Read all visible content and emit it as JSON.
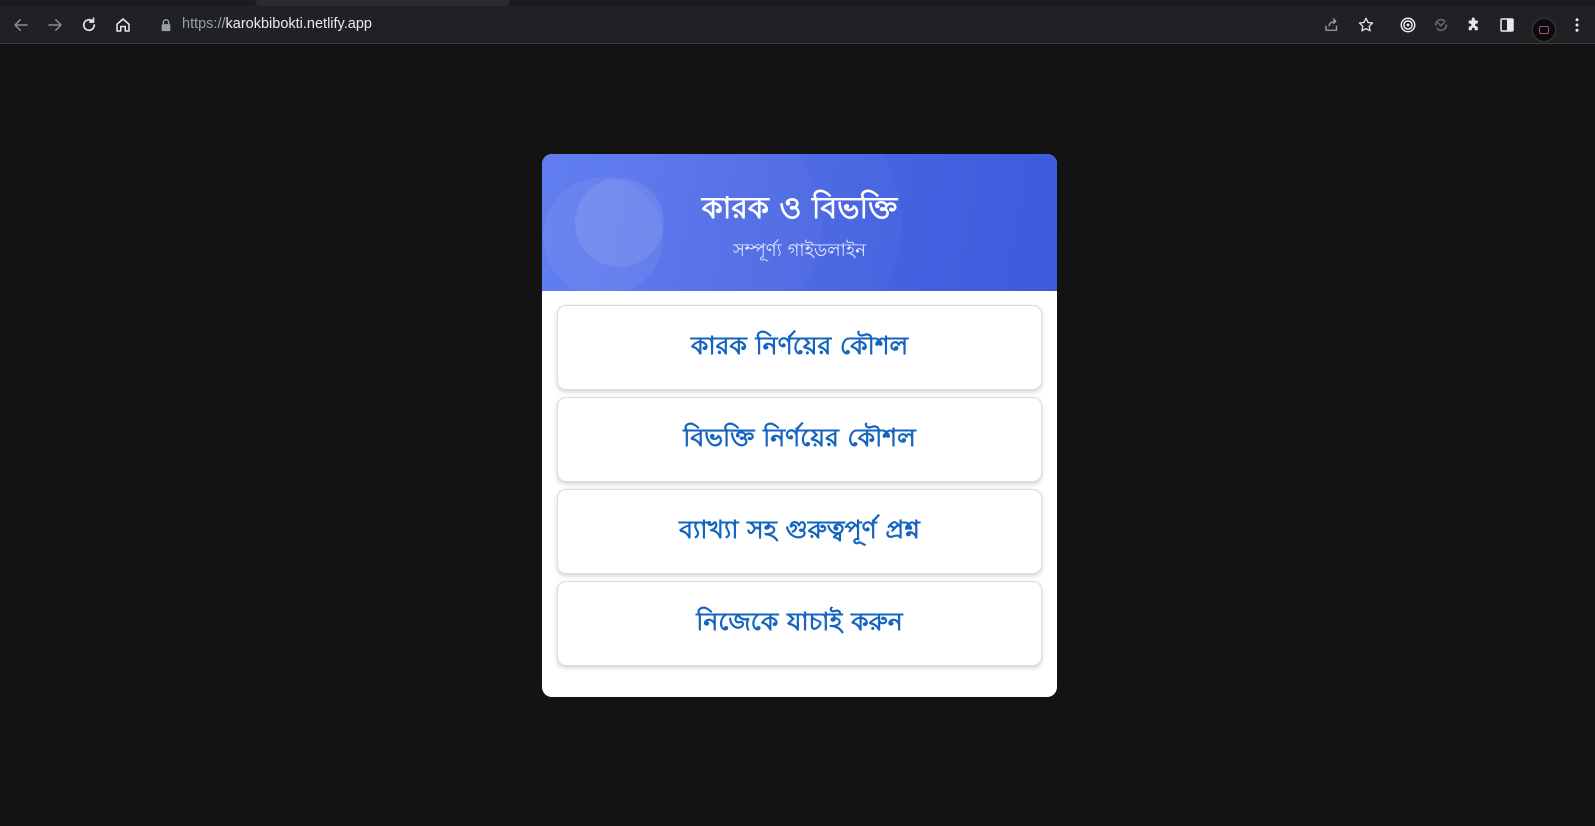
{
  "browser": {
    "url_scheme": "https://",
    "url_host": "karokbibokti.netlify.app"
  },
  "icons": {
    "back": "arrow-left-icon",
    "forward": "arrow-right-icon",
    "reload": "reload-icon",
    "home": "home-icon",
    "lock": "lock-icon",
    "share": "share-icon",
    "bookmark": "star-icon",
    "extension1": "target-icon",
    "extension2": "sync-icon",
    "extensions": "puzzle-icon",
    "sidepanel": "side-panel-icon",
    "menu": "kebab-menu-icon"
  },
  "colors": {
    "header_gradient_start": "#5a78f0",
    "header_gradient_end": "#3b5bdb",
    "button_text": "#1565c0",
    "page_background": "#131313"
  },
  "card": {
    "title": "কারক ও বিভক্তি",
    "subtitle": "সম্পূর্ণ্য গাইডলাইন",
    "menu": [
      {
        "label": "কারক নির্ণয়ের কৌশল"
      },
      {
        "label": "বিভক্তি নির্ণয়ের কৌশল"
      },
      {
        "label": "ব্যাখ্যা সহ গুরুত্বপূর্ণ প্রশ্ন"
      },
      {
        "label": "নিজেকে যাচাই করুন"
      }
    ]
  }
}
